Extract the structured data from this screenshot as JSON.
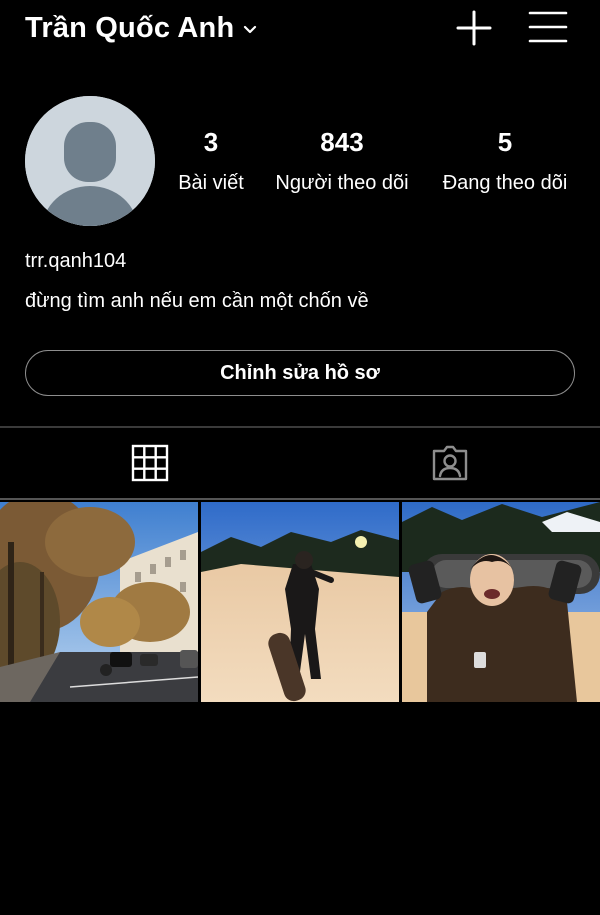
{
  "header": {
    "display_name": "Trần Quốc Anh",
    "icons": {
      "dropdown": "chevron-down-icon",
      "create": "plus-icon",
      "menu": "hamburger-menu-icon"
    }
  },
  "profile": {
    "avatar_icon": "default-avatar-icon",
    "stats": {
      "posts": {
        "value": "3",
        "label": "Bài viết"
      },
      "followers": {
        "value": "843",
        "label": "Người theo dõi"
      },
      "following": {
        "value": "5",
        "label": "Đang theo dõi"
      }
    },
    "handle": "trr.qanh104",
    "bio": "đừng tìm anh nếu em cần một chốn về",
    "edit_button_label": "Chỉnh sửa hồ sơ"
  },
  "tabs": [
    {
      "name": "grid",
      "icon": "grid-icon",
      "active": true
    },
    {
      "name": "tagged",
      "icon": "tagged-person-icon",
      "active": false
    }
  ],
  "posts": [
    {
      "description": "tree-lined Paris street with cars",
      "icon": "photo-street"
    },
    {
      "description": "person holding snowboard on snowy slope at dusk",
      "icon": "photo-snowboard-1"
    },
    {
      "description": "smiling person holding snowboard behind head",
      "icon": "photo-snowboard-2"
    }
  ],
  "colors": {
    "background": "#000000",
    "text": "#ffffff",
    "border": "#8e8e8e",
    "avatar_bg": "#cdd6dd",
    "avatar_fg": "#6f7f8c"
  }
}
